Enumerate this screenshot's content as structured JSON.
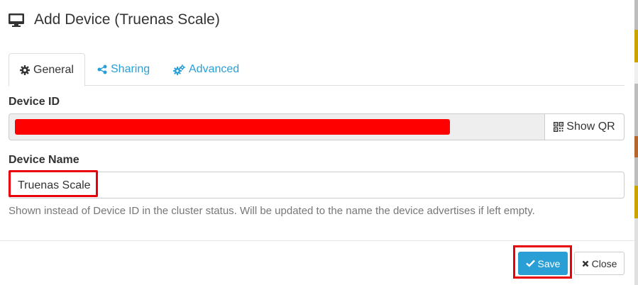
{
  "header": {
    "icon": "desktop-icon",
    "title": "Add Device (Truenas Scale)"
  },
  "tabs": [
    {
      "label": "General",
      "icon": "gear-icon",
      "active": true
    },
    {
      "label": "Sharing",
      "icon": "share-icon",
      "active": false
    },
    {
      "label": "Advanced",
      "icon": "cogs-icon",
      "active": false
    }
  ],
  "device_id": {
    "label": "Device ID",
    "show_qr_label": "Show QR",
    "qr_icon": "qrcode-icon"
  },
  "device_name": {
    "label": "Device Name",
    "value": "Truenas Scale",
    "help": "Shown instead of Device ID in the cluster status. Will be updated to the name the device advertises if left empty."
  },
  "footer": {
    "save_label": "Save",
    "save_icon": "check-icon",
    "close_label": "Close",
    "close_icon": "close-icon"
  },
  "colors": {
    "accent": "#2a9fd6",
    "highlight": "#e8000b",
    "redaction": "#ff0000"
  }
}
